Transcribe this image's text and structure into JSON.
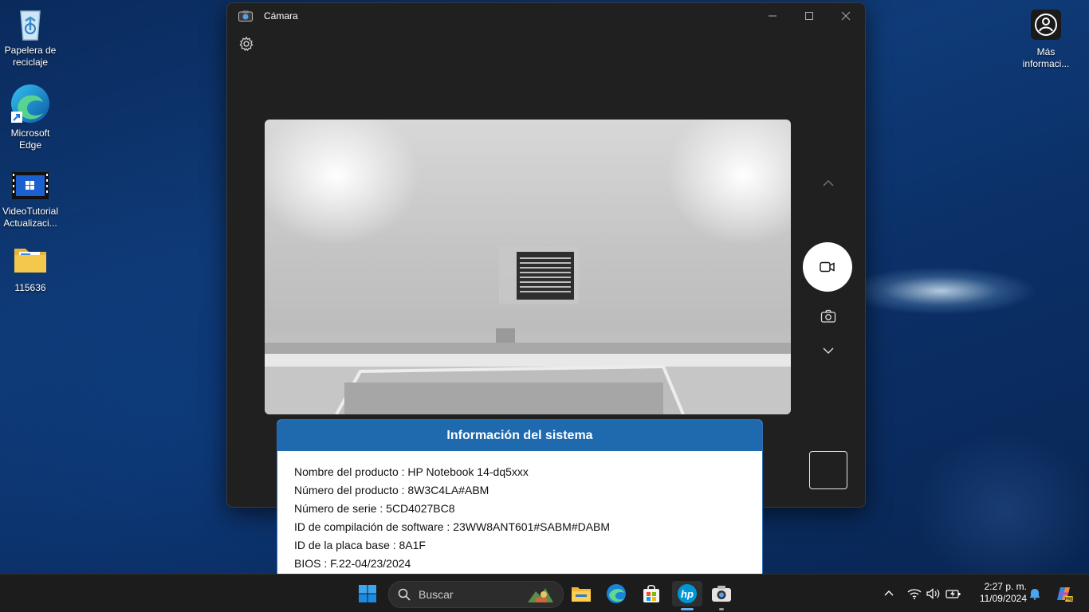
{
  "desktop": {
    "icons": [
      {
        "label": "Papelera de reciclaje",
        "icon": "recycle-bin-icon"
      },
      {
        "label": "Microsoft Edge",
        "icon": "edge-icon"
      },
      {
        "label": "VideoTutorial Actualizaci...",
        "icon": "video-file-icon"
      },
      {
        "label": "115636",
        "icon": "folder-icon"
      },
      {
        "label": "Más informaci...",
        "icon": "learn-more-icon"
      }
    ]
  },
  "camera_window": {
    "title": "Cámara",
    "controls": [
      "minimize-icon",
      "maximize-icon",
      "close-icon"
    ],
    "settings_icon": "gear-icon",
    "side_controls": [
      "chevron-up-icon",
      "video-mode-button",
      "photo-mode-button",
      "chevron-down-icon",
      "gallery-thumbnail"
    ]
  },
  "system_info": {
    "title": "Información del sistema",
    "rows": [
      "Nombre del producto : HP Notebook 14-dq5xxx",
      "Número del producto : 8W3C4LA#ABM",
      "Número de serie : 5CD4027BC8",
      "ID de compilación de software : 23WW8ANT601#SABM#DABM",
      "ID de la placa base : 8A1F",
      "BIOS : F.22-04/23/2024"
    ]
  },
  "taskbar": {
    "search_placeholder": "Buscar",
    "pinned": [
      "start-icon",
      "file-explorer-icon",
      "edge-icon",
      "store-icon",
      "hp-icon",
      "camera-icon"
    ],
    "tray": [
      "chevron-up-icon",
      "wifi-icon",
      "volume-icon",
      "battery-icon"
    ],
    "time": "2:27 p. m.",
    "date": "11/09/2024",
    "accent": "#1f6aae"
  }
}
